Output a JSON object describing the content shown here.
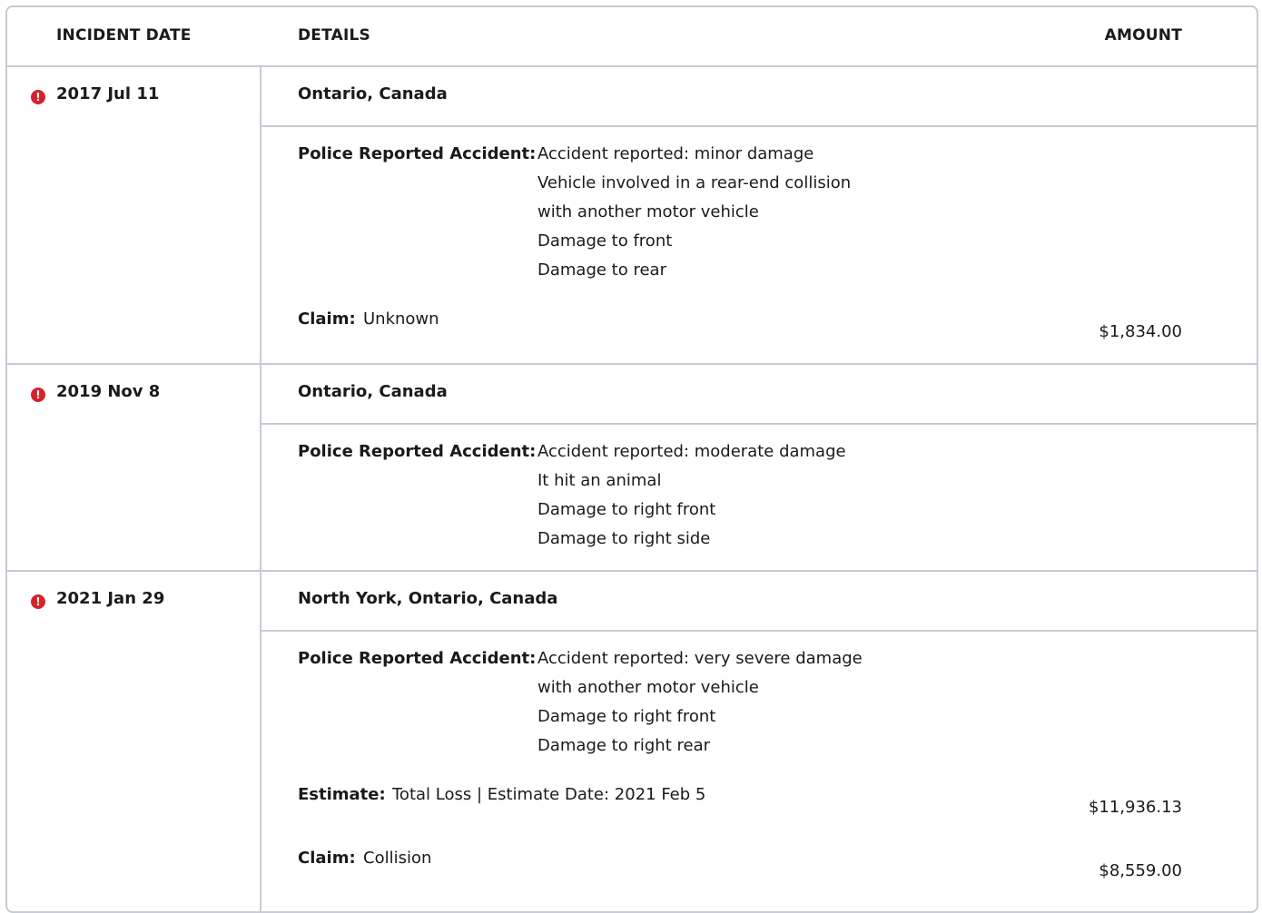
{
  "table": {
    "headers": {
      "incident_date": "INCIDENT DATE",
      "details": "DETAILS",
      "amount": "AMOUNT"
    },
    "incidents": [
      {
        "date": "2017 Jul 11",
        "location": "Ontario, Canada",
        "police_label": "Police Reported Accident:",
        "police_lines": [
          "Accident reported: minor damage",
          "Vehicle involved in a rear-end collision",
          "with another motor vehicle",
          "Damage to front",
          "Damage to rear"
        ],
        "claim_label": "Claim:",
        "claim_value": "Unknown",
        "claim_amount": "$1,834.00"
      },
      {
        "date": "2019 Nov 8",
        "location": "Ontario, Canada",
        "police_label": "Police Reported Accident:",
        "police_lines": [
          "Accident reported: moderate damage",
          "It hit an animal",
          "Damage to right front",
          "Damage to right side"
        ]
      },
      {
        "date": "2021 Jan 29",
        "location": "North York, Ontario, Canada",
        "police_label": "Police Reported Accident:",
        "police_lines": [
          "Accident reported: very severe damage",
          "with another motor vehicle",
          "Damage to right front",
          "Damage to right rear"
        ],
        "estimate_label": "Estimate:",
        "estimate_value": "Total Loss | Estimate Date: 2021 Feb 5",
        "estimate_amount": "$11,936.13",
        "claim_label": "Claim:",
        "claim_value": "Collision",
        "claim_amount": "$8,559.00"
      }
    ],
    "alert_icon": "exclamation-circle-icon",
    "alert_color": "#d6222d",
    "border_color": "#c6ccd3"
  }
}
